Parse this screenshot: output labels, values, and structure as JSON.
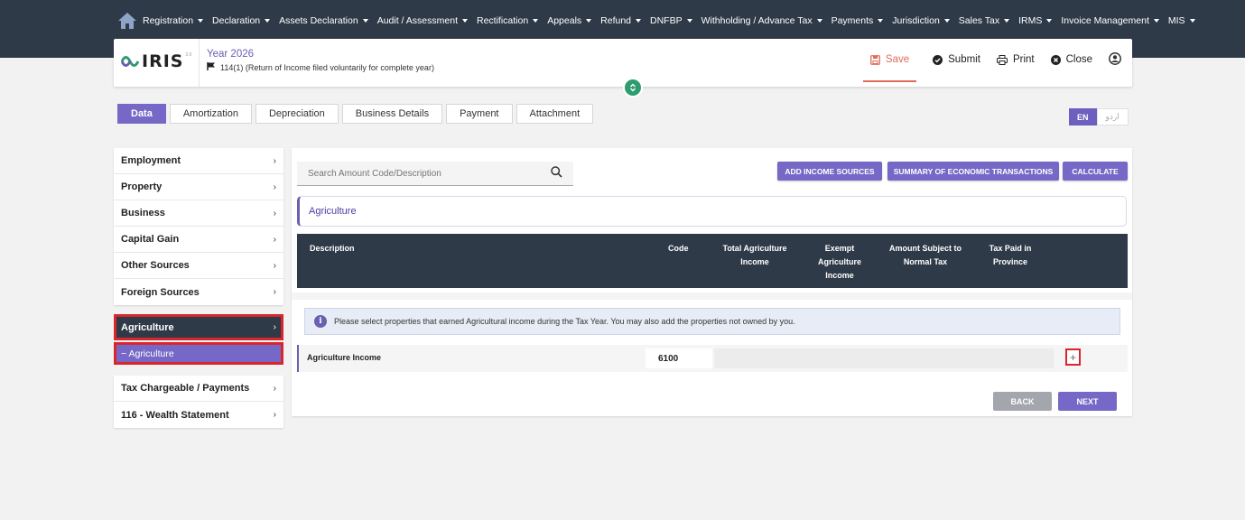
{
  "nav": {
    "items": [
      "Registration",
      "Declaration",
      "Assets Declaration",
      "Audit / Assessment",
      "Rectification",
      "Appeals",
      "Refund",
      "DNFBP",
      "Withholding / Advance Tax",
      "Payments",
      "Jurisdiction",
      "Sales Tax",
      "IRMS",
      "Invoice Management",
      "MIS"
    ]
  },
  "header": {
    "logo_text": "IRIS",
    "logo_sup": "2.0",
    "year": "Year 2026",
    "return_desc": "114(1) (Return of Income filed voluntarily for complete year)",
    "actions": {
      "save": "Save",
      "submit": "Submit",
      "print": "Print",
      "close": "Close"
    }
  },
  "tabs": [
    "Data",
    "Amortization",
    "Depreciation",
    "Business Details",
    "Payment",
    "Attachment"
  ],
  "lang": {
    "en": "EN",
    "ur": "اردو"
  },
  "sidebar": {
    "group1": [
      "Employment",
      "Property",
      "Business",
      "Capital Gain",
      "Other Sources",
      "Foreign Sources"
    ],
    "active": "Agriculture",
    "active_sub": "− Agriculture",
    "group2": [
      "Tax Chargeable / Payments",
      "116 - Wealth Statement"
    ]
  },
  "main": {
    "search_placeholder": "Search Amount Code/Description",
    "buttons": {
      "add_income": "ADD INCOME SOURCES",
      "summary": "SUMMARY OF ECONOMIC TRANSACTIONS",
      "calculate": "CALCULATE"
    },
    "section_title": "Agriculture",
    "columns": {
      "description": "Description",
      "code": "Code",
      "total_line1": "Total Agriculture",
      "total_line2": "Income",
      "exempt_line1": "Exempt",
      "exempt_line2": "Agriculture",
      "exempt_line3": "Income",
      "subject_line1": "Amount Subject to",
      "subject_line2": "Normal Tax",
      "taxpaid_line1": "Tax Paid in",
      "taxpaid_line2": "Province"
    },
    "info": "Please select properties that earned Agricultural income during the Tax Year. You may also add the properties not owned by you.",
    "row": {
      "label": "Agriculture Income",
      "code": "6100",
      "add": "+"
    },
    "back": "BACK",
    "next": "NEXT"
  }
}
